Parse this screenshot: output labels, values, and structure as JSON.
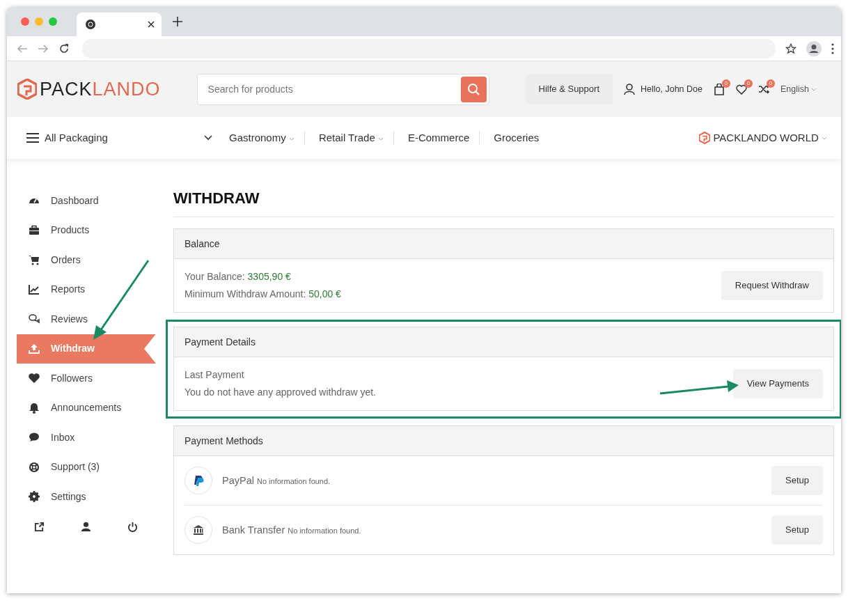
{
  "header": {
    "logo": {
      "dark": "PACK",
      "accent": "LANDO"
    },
    "search": {
      "placeholder": "Search for products"
    },
    "help_button": "Hilfe & Support",
    "greeting": "Hello, John Doe",
    "counters": [
      {
        "kind": "bag",
        "count": "0"
      },
      {
        "kind": "heart",
        "count": "0"
      },
      {
        "kind": "shuffle",
        "count": "0"
      }
    ],
    "language": "English"
  },
  "nav": {
    "menu_label": "All Packaging",
    "items": [
      {
        "label": "Gastronomy",
        "dropdown": true
      },
      {
        "label": "Retail Trade",
        "dropdown": true
      },
      {
        "label": "E-Commerce",
        "dropdown": false
      },
      {
        "label": "Groceries",
        "dropdown": false
      }
    ],
    "world": "PACKLANDO WORLD"
  },
  "sidebar": {
    "items": [
      {
        "label": "Dashboard",
        "kind": "gauge",
        "selected": false
      },
      {
        "label": "Products",
        "kind": "briefcase",
        "selected": false
      },
      {
        "label": "Orders",
        "kind": "cart",
        "selected": false
      },
      {
        "label": "Reports",
        "kind": "chart",
        "selected": false
      },
      {
        "label": "Reviews",
        "kind": "comments",
        "selected": false
      },
      {
        "label": "Withdraw",
        "kind": "upload",
        "selected": true
      },
      {
        "label": "Followers",
        "kind": "heart",
        "selected": false
      },
      {
        "label": "Announcements",
        "kind": "bell",
        "selected": false
      },
      {
        "label": "Inbox",
        "kind": "bubble",
        "selected": false
      },
      {
        "label": "Support (3)",
        "kind": "lifebuoy",
        "selected": false
      },
      {
        "label": "Settings",
        "kind": "gear",
        "selected": false
      }
    ],
    "footer_icons": [
      {
        "kind": "external"
      },
      {
        "kind": "user"
      },
      {
        "kind": "power"
      }
    ]
  },
  "page": {
    "title": "WITHDRAW",
    "balance": {
      "header": "Balance",
      "lines": [
        {
          "label": "Your Balance:",
          "value": "3305,90 €"
        },
        {
          "label": "Minimum Withdraw Amount:",
          "value": "50,00 €"
        }
      ],
      "button": "Request Withdraw"
    },
    "payment_details": {
      "header": "Payment Details",
      "label": "Last Payment",
      "message": "You do not have any approved withdraw yet.",
      "button": "View Payments"
    },
    "payment_methods": {
      "header": "Payment Methods",
      "items": [
        {
          "kind": "paypal",
          "name": "PayPal",
          "note": "No information found.",
          "button": "Setup"
        },
        {
          "kind": "bank",
          "name": "Bank Transfer",
          "note": "No information found.",
          "button": "Setup"
        }
      ]
    }
  }
}
